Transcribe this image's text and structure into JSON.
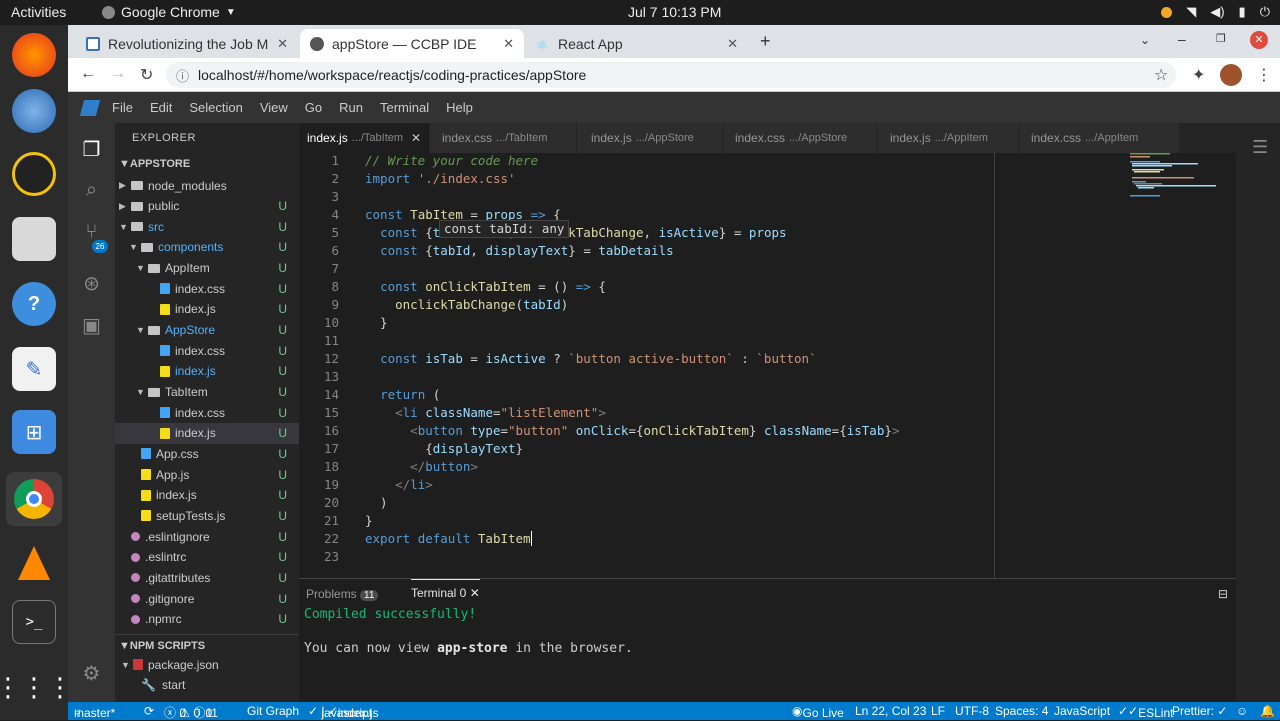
{
  "topbar": {
    "activities": "Activities",
    "app": "Google Chrome",
    "clock": "Jul 7  10:13 PM"
  },
  "chrome": {
    "tabs": [
      {
        "title": "Revolutionizing the Job M"
      },
      {
        "title": "appStore — CCBP IDE"
      },
      {
        "title": "React App"
      }
    ],
    "url": "localhost/#/home/workspace/reactjs/coding-practices/appStore"
  },
  "ide": {
    "menu": [
      "File",
      "Edit",
      "Selection",
      "View",
      "Go",
      "Run",
      "Terminal",
      "Help"
    ],
    "explorer_title": "EXPLORER",
    "root": "APPSTORE",
    "tree": [
      {
        "label": "node_modules",
        "badge": "",
        "kind": "folder",
        "depth": 1
      },
      {
        "label": "public",
        "badge": "U",
        "kind": "folder",
        "depth": 1
      },
      {
        "label": "src",
        "badge": "U",
        "kind": "folder",
        "depth": 1
      },
      {
        "label": "components",
        "badge": "U",
        "kind": "folder",
        "depth": 2
      },
      {
        "label": "AppItem",
        "badge": "U",
        "kind": "folder",
        "depth": 3
      },
      {
        "label": "index.css",
        "badge": "U",
        "kind": "css",
        "depth": 4
      },
      {
        "label": "index.js",
        "badge": "U",
        "kind": "js",
        "depth": 4
      },
      {
        "label": "AppStore",
        "badge": "U",
        "kind": "folder",
        "depth": 3
      },
      {
        "label": "index.css",
        "badge": "U",
        "kind": "css",
        "depth": 4
      },
      {
        "label": "index.js",
        "badge": "U",
        "kind": "js",
        "depth": 4
      },
      {
        "label": "TabItem",
        "badge": "U",
        "kind": "folder",
        "depth": 3
      },
      {
        "label": "index.css",
        "badge": "U",
        "kind": "css",
        "depth": 4
      },
      {
        "label": "index.js",
        "badge": "U",
        "kind": "js",
        "depth": 4
      },
      {
        "label": "App.css",
        "badge": "U",
        "kind": "css",
        "depth": 2
      },
      {
        "label": "App.js",
        "badge": "U",
        "kind": "js",
        "depth": 2
      },
      {
        "label": "index.js",
        "badge": "U",
        "kind": "js",
        "depth": 2
      },
      {
        "label": "setupTests.js",
        "badge": "U",
        "kind": "js",
        "depth": 2
      },
      {
        "label": ".eslintignore",
        "badge": "U",
        "kind": "dot",
        "depth": 1
      },
      {
        "label": ".eslintrc",
        "badge": "U",
        "kind": "dot",
        "depth": 1
      },
      {
        "label": ".gitattributes",
        "badge": "U",
        "kind": "dot",
        "depth": 1
      },
      {
        "label": ".gitignore",
        "badge": "U",
        "kind": "dot",
        "depth": 1
      },
      {
        "label": ".npmrc",
        "badge": "U",
        "kind": "dot",
        "depth": 1
      }
    ],
    "npm_section": "NPM SCRIPTS",
    "npm_items": [
      "package.json",
      "start"
    ],
    "editor_tabs": [
      {
        "file": "index.js",
        "dir": ".../TabItem"
      },
      {
        "file": "index.css",
        "dir": ".../TabItem"
      },
      {
        "file": "index.js",
        "dir": ".../AppStore"
      },
      {
        "file": "index.css",
        "dir": ".../AppStore"
      },
      {
        "file": "index.js",
        "dir": ".../AppItem"
      },
      {
        "file": "index.css",
        "dir": ".../AppItem"
      }
    ],
    "hover": "const tabId: any",
    "panel": {
      "problems": "Problems",
      "problems_count": "11",
      "terminal": "Terminal 0",
      "line1": "Compiled successfully!",
      "line2_pre": "You can now view ",
      "line2_app": "app-store",
      "line2_post": " in the browser."
    }
  },
  "status": {
    "branch": "master*",
    "errors": "0",
    "warnings": "0",
    "infos": "0",
    "count": "11",
    "gitgraph": "Git Graph",
    "lang_check": "javascript",
    "file": "index.js",
    "golive": "Go Live",
    "position": "Ln 22, Col 23",
    "eol": "LF",
    "encoding": "UTF-8",
    "spaces": "Spaces: 4",
    "language": "JavaScript",
    "eslint": "ESLint",
    "prettier": "Prettier: ✓"
  }
}
